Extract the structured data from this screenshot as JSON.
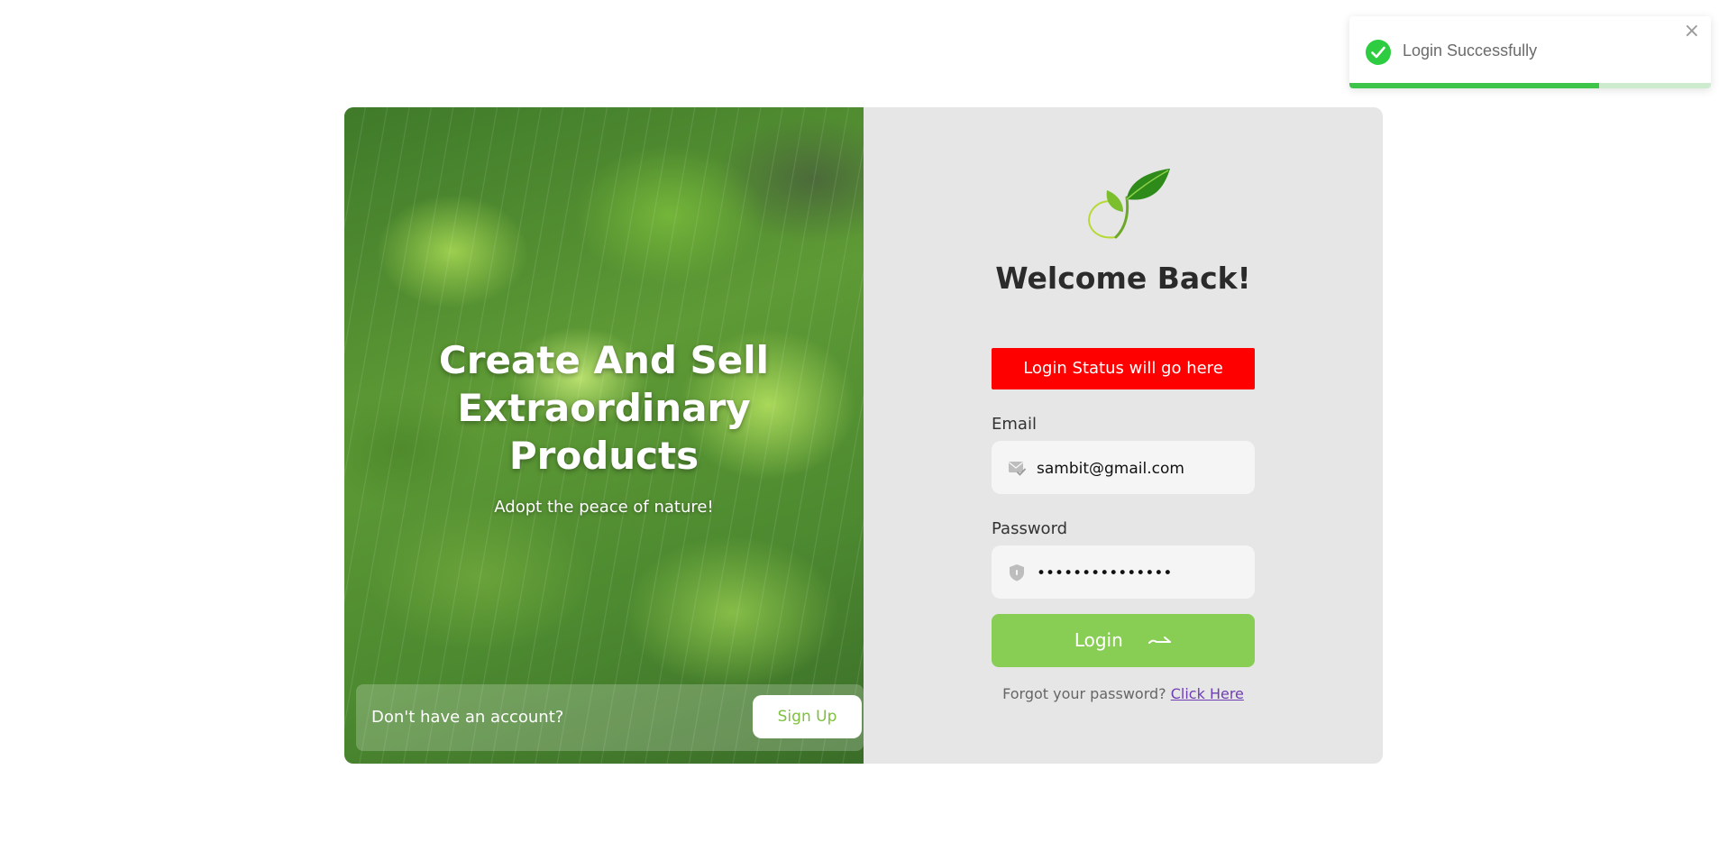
{
  "toast": {
    "message": "Login Successfully",
    "close_glyph": "×",
    "progress_fraction": 0.69,
    "accent_color": "#2ecc40"
  },
  "hero": {
    "title_lines": [
      "Create And Sell",
      "Extraordinary",
      "Products"
    ],
    "subtitle": "Adopt the peace of nature!",
    "signup_prompt": "Don't have an account?",
    "signup_label": "Sign Up"
  },
  "form": {
    "heading": "Welcome Back!",
    "status_text": "Login Status will go here",
    "status_color": "#ff0000",
    "email_label": "Email",
    "email_value": "sambit@gmail.com",
    "password_label": "Password",
    "password_value": "sambit123456789",
    "login_label": "Login",
    "forgot_prompt": "Forgot your password?",
    "forgot_link": "Click Here",
    "brand_color": "#88ce55"
  },
  "icons": {
    "logo": "leaf-sprout-icon",
    "email": "mail-check-icon",
    "password": "shield-lock-icon",
    "login_arrow": "arrow-right-icon",
    "toast_status": "check-circle-icon",
    "toast_close": "close-icon"
  }
}
